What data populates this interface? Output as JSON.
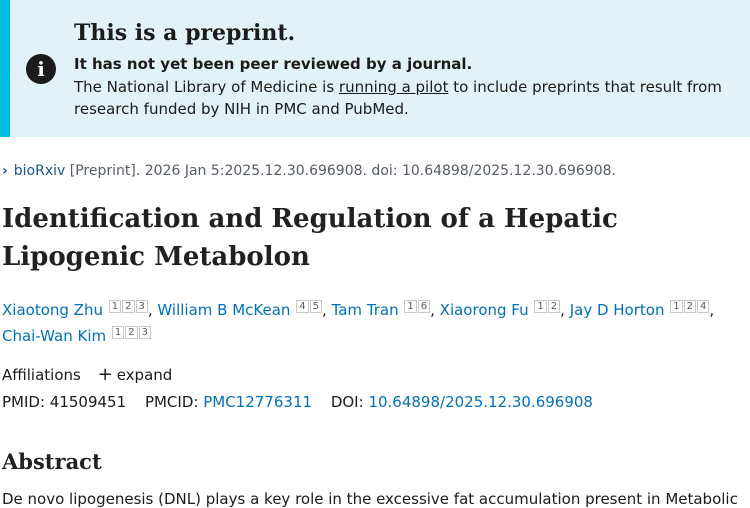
{
  "banner": {
    "title": "This is a preprint.",
    "strong": "It has not yet been peer reviewed by a journal.",
    "text_before": "The National Library of Medicine is ",
    "link": "running a pilot",
    "text_after": " to include preprints that result from research funded by NIH in PMC and PubMed.",
    "icon": "info-icon"
  },
  "citation": {
    "source": "bioRxiv",
    "details": "[Preprint]. 2026 Jan 5:2025.12.30.696908. doi: 10.64898/2025.12.30.696908."
  },
  "article": {
    "title": "Identification and Regulation of a Hepatic Lipogenic Metabolon"
  },
  "authors": [
    {
      "name": "Xiaotong Zhu",
      "affils": [
        "1",
        "2",
        "3"
      ]
    },
    {
      "name": "William B McKean",
      "affils": [
        "4",
        "5"
      ]
    },
    {
      "name": "Tam Tran",
      "affils": [
        "1",
        "6"
      ]
    },
    {
      "name": "Xiaorong Fu",
      "affils": [
        "1",
        "2"
      ]
    },
    {
      "name": "Jay D Horton",
      "affils": [
        "1",
        "2",
        "4"
      ]
    },
    {
      "name": "Chai-Wan Kim",
      "affils": [
        "1",
        "2",
        "3"
      ]
    }
  ],
  "affiliations": {
    "label": "Affiliations",
    "expand": "expand"
  },
  "ids": {
    "pmid_label": "PMID:",
    "pmid": "41509451",
    "pmcid_label": "PMCID:",
    "pmcid": "PMC12776311",
    "doi_label": "DOI:",
    "doi": "10.64898/2025.12.30.696908"
  },
  "abstract": {
    "heading": "Abstract",
    "text": "De novo lipogenesis (DNL) plays a key role in the excessive fat accumulation present in Metabolic"
  },
  "colors": {
    "banner_bg": "#e1f3f8",
    "banner_accent": "#00bde3",
    "link": "#0071bc"
  }
}
